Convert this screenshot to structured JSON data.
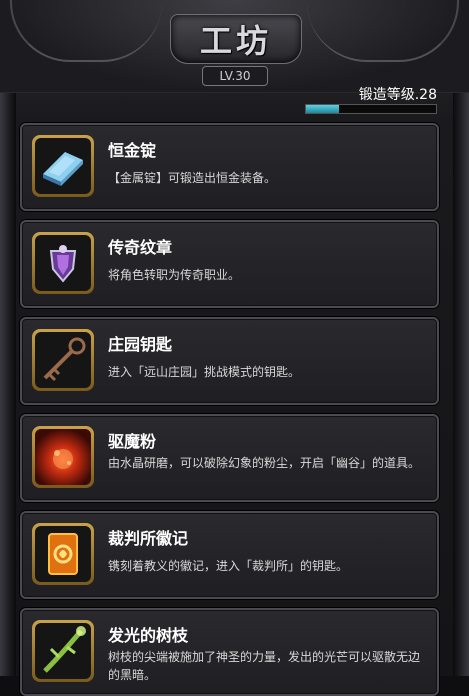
{
  "header": {
    "title": "工坊",
    "level": "LV.30"
  },
  "forge": {
    "label": "锻造等级.28",
    "progress": 0.25
  },
  "items": [
    {
      "name": "恒金锭",
      "desc": "【金属锭】可锻造出恒金装备。",
      "icon": "ingot-icon"
    },
    {
      "name": "传奇纹章",
      "desc": "将角色转职为传奇职业。",
      "icon": "emblem-icon"
    },
    {
      "name": "庄园钥匙",
      "desc": "进入「远山庄园」挑战模式的钥匙。",
      "icon": "key-icon"
    },
    {
      "name": "驱魔粉",
      "desc": "由水晶研磨，可以破除幻象的粉尘，开启「幽谷」的道具。",
      "icon": "powder-icon"
    },
    {
      "name": "裁判所徽记",
      "desc": "镌刻着教义的徽记，进入「裁判所」的钥匙。",
      "icon": "badge-icon"
    },
    {
      "name": "发光的树枝",
      "desc": "树枝的尖端被施加了神圣的力量，发出的光芒可以驱散无边的黑暗。",
      "icon": "branch-icon"
    }
  ]
}
